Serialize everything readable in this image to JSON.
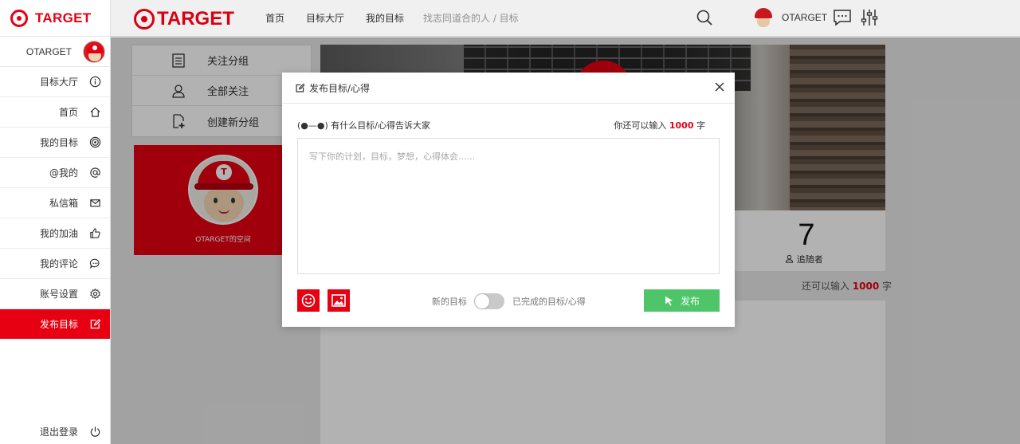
{
  "sidebar": {
    "brand": "TARGET",
    "user_name": "OTARGET",
    "items": [
      {
        "label": "目标大厅",
        "icon": "info-circle-icon"
      },
      {
        "label": "首页",
        "icon": "home-icon"
      },
      {
        "label": "我的目标",
        "icon": "target-icon"
      },
      {
        "label": "@我的",
        "icon": "at-icon"
      },
      {
        "label": "私信箱",
        "icon": "mail-icon"
      },
      {
        "label": "我的加油",
        "icon": "thumbs-up-icon"
      },
      {
        "label": "我的评论",
        "icon": "comment-icon"
      },
      {
        "label": "账号设置",
        "icon": "gear-icon"
      },
      {
        "label": "发布目标",
        "icon": "edit-icon",
        "active": true
      }
    ],
    "logout_label": "退出登录",
    "accent_color": "#e60012"
  },
  "header": {
    "logo_text": "TARGET",
    "nav": [
      "首页",
      "目标大厅",
      "我的目标"
    ],
    "search_placeholder": "找志同道合的人 / 目标",
    "user_name": "OTARGET"
  },
  "groups": {
    "items": [
      {
        "label": "关注分组",
        "icon": "list-icon"
      },
      {
        "label": "全部关注",
        "icon": "user-icon"
      },
      {
        "label": "创建新分组",
        "icon": "add-document-icon"
      }
    ]
  },
  "profile": {
    "space_label": "OTARGET的空间",
    "badge_letter": "T"
  },
  "stats": {
    "followers_count": "7",
    "followers_label": "追随者"
  },
  "background_remaining": {
    "prefix": "还可以输入 ",
    "count": "1000",
    "suffix": " 字"
  },
  "modal": {
    "title": "发布目标/心得",
    "prompt": "(●—●) 有什么目标/心得告诉大家",
    "remaining_prefix": "你还可以输入 ",
    "remaining_count": "1000",
    "remaining_suffix": " 字",
    "textarea_placeholder": "写下你的计划，目标，梦想，心得体会......",
    "textarea_value": "",
    "toggle_left_label": "新的目标",
    "toggle_right_label": "已完成的目标/心得",
    "toggle_state": "off",
    "publish_label": "发布",
    "publish_color": "#4ec569"
  }
}
